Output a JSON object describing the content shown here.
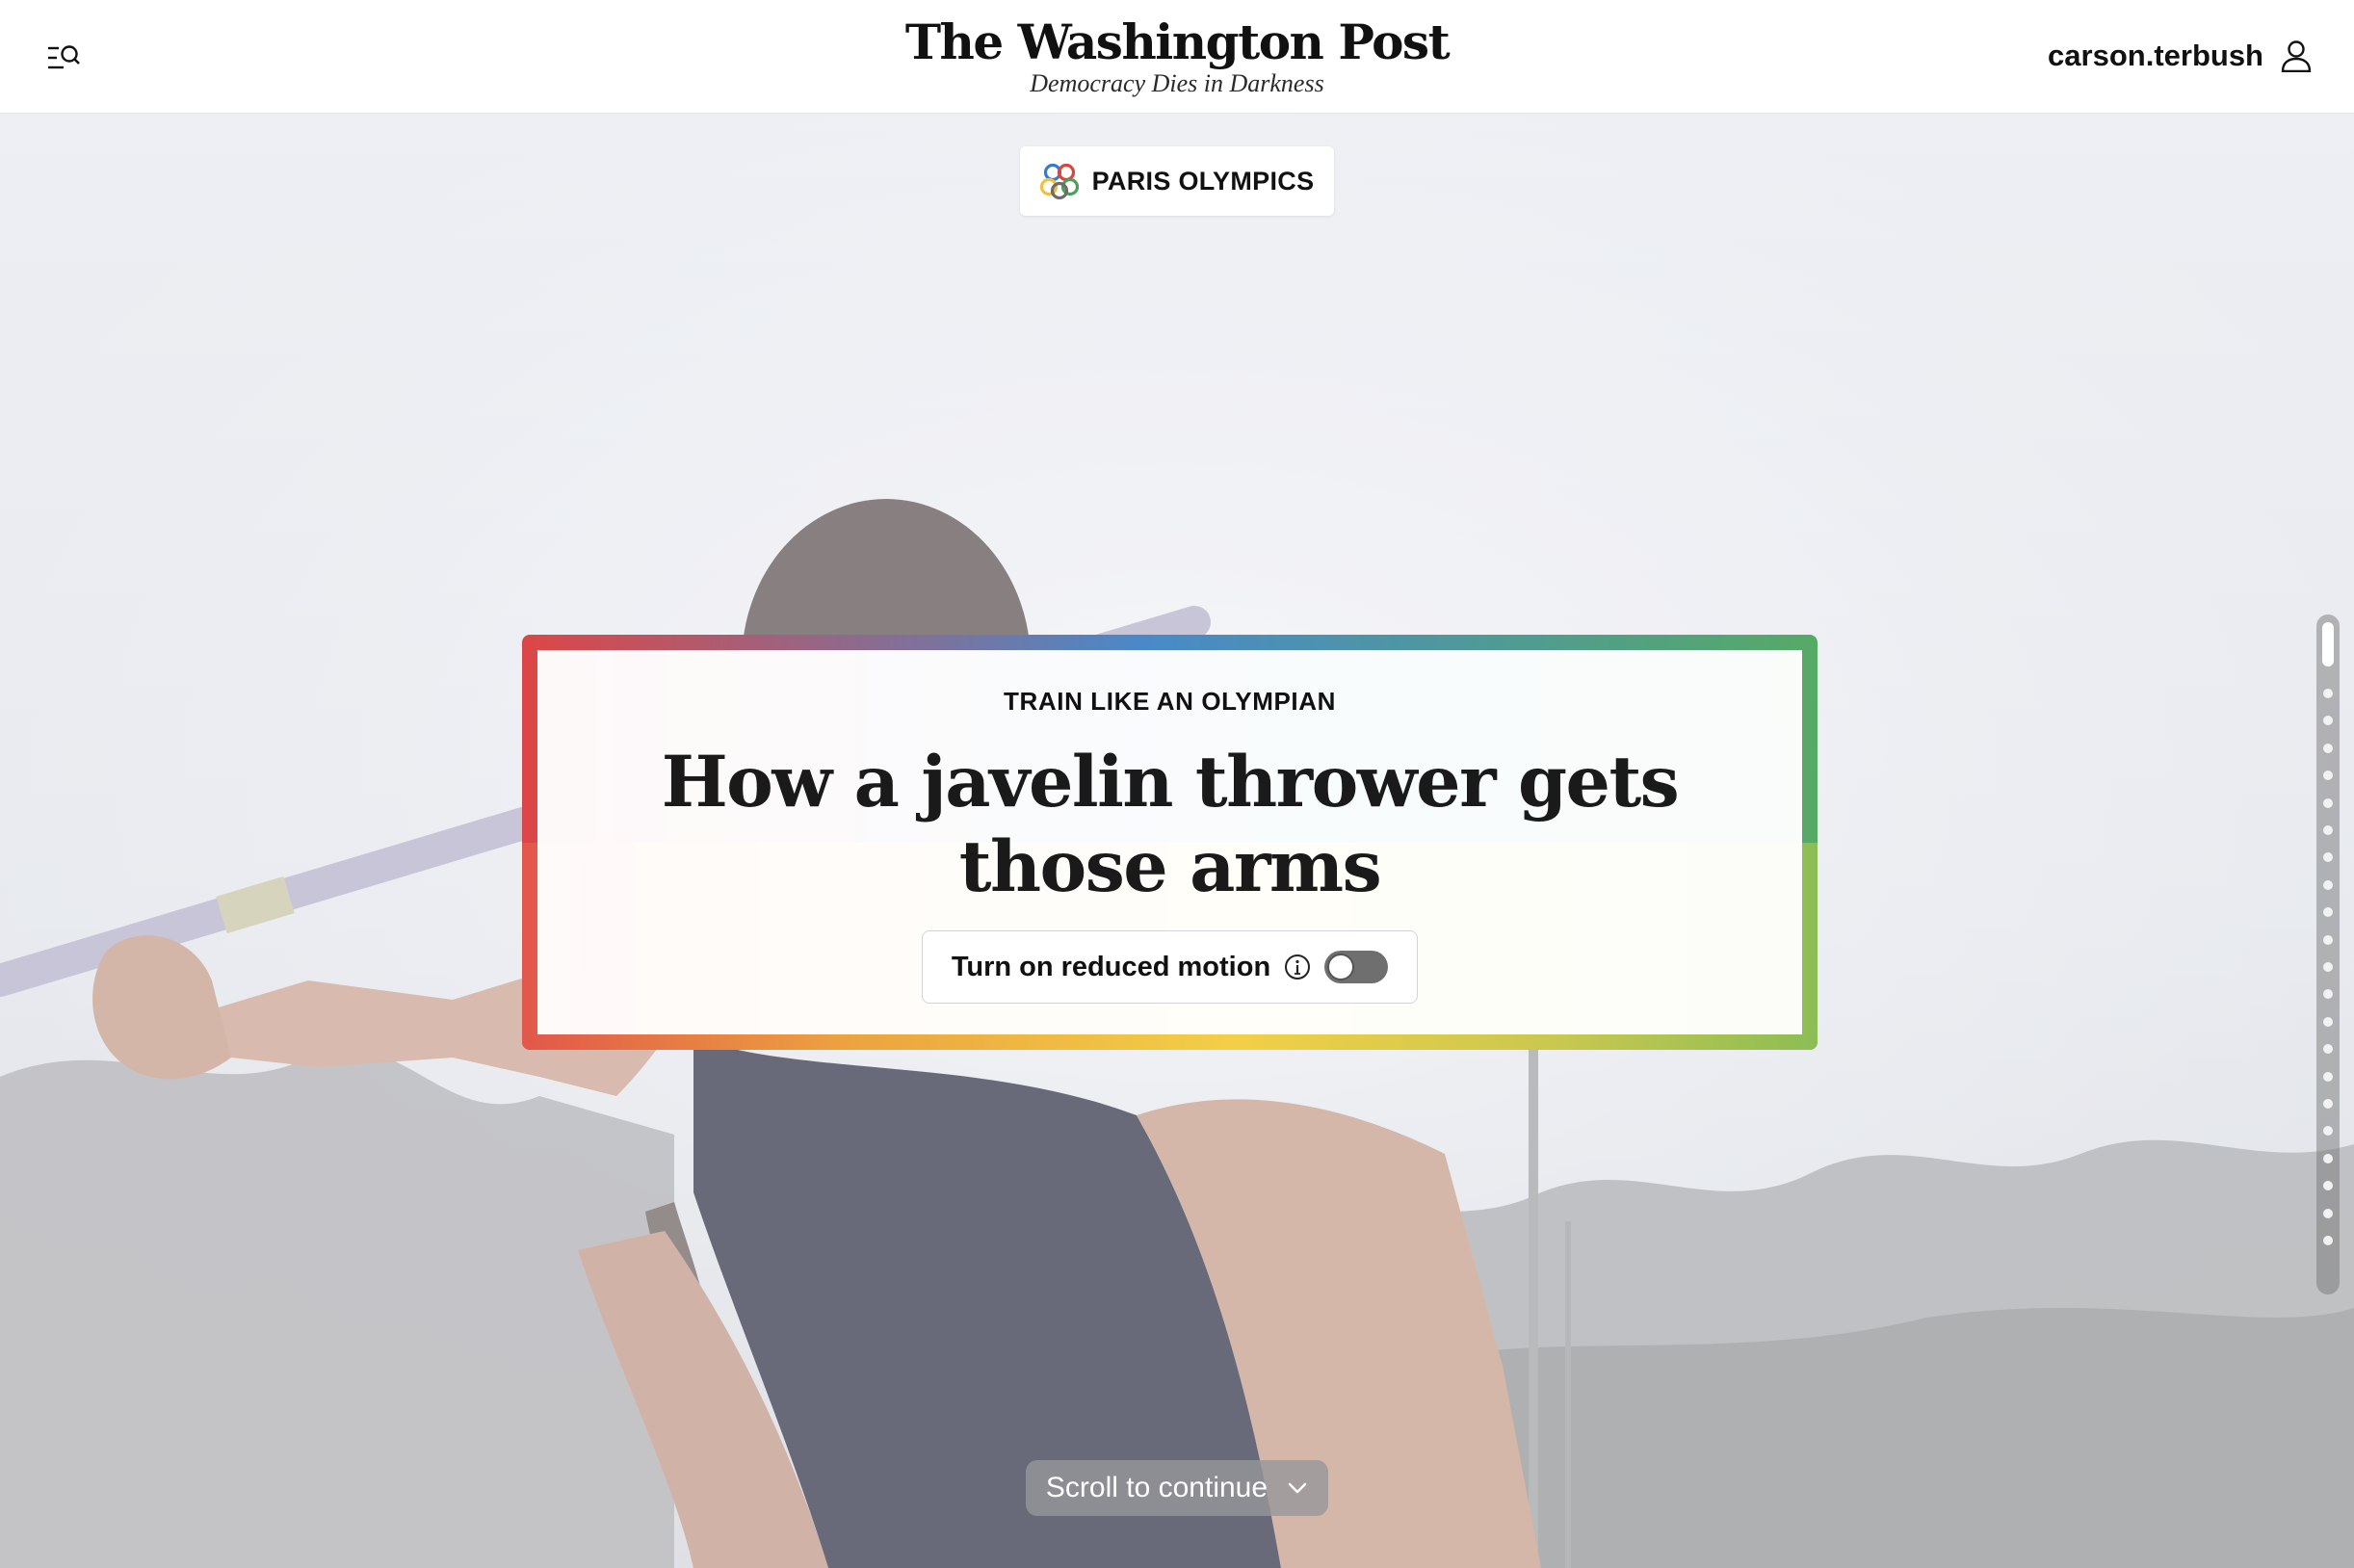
{
  "header": {
    "logo_name": "The Washington Post",
    "logo_tagline": "Democracy Dies in Darkness",
    "username": "carson.terbush",
    "menu_icon": "menu-search-icon",
    "user_icon": "user-icon"
  },
  "section": {
    "label": "PARIS OLYMPICS",
    "icon": "olympic-rings-icon"
  },
  "article": {
    "kicker": "TRAIN LIKE AN OLYMPIAN",
    "headline": "How a javelin thrower gets those arms"
  },
  "motion_control": {
    "label": "Turn on reduced motion",
    "info_icon": "info-icon",
    "enabled": false
  },
  "scroll": {
    "label": "Scroll to continue",
    "icon": "chevron-down-icon"
  },
  "progress": {
    "sections": 22,
    "current": 1
  },
  "colors": {
    "rainbow": [
      "#dd4646",
      "#4a89c9",
      "#56aa66",
      "#f3cf46",
      "#eca33f"
    ],
    "overlay": "#e9ebf1"
  }
}
